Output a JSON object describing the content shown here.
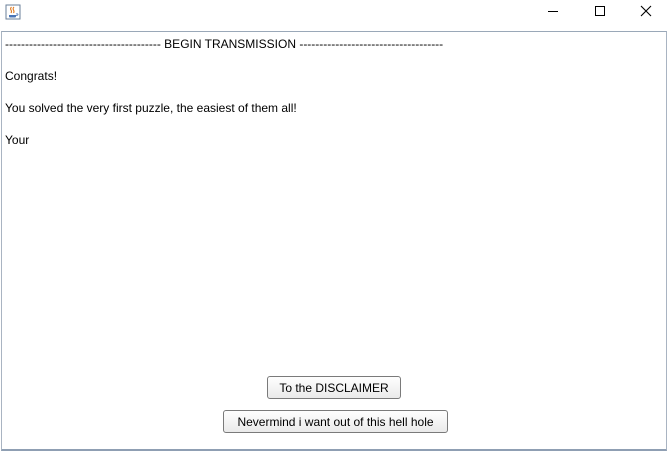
{
  "window": {
    "controls": {
      "minimize_icon": "minimize-icon",
      "maximize_icon": "maximize-icon",
      "close_icon": "close-icon"
    },
    "app_icon": "java-coffee-cup-icon"
  },
  "message": {
    "lines": [
      "--------------------------------------- BEGIN TRANSMISSION ------------------------------------",
      "Congrats!",
      "You solved the very first puzzle, the easiest of them all!",
      "Your"
    ]
  },
  "buttons": {
    "disclaimer_label": "To the DISCLAIMER",
    "exit_label": "Nevermind i want out of this hell hole"
  },
  "colors": {
    "border": "#9aa8b8",
    "button_border": "#7a7a7a"
  }
}
